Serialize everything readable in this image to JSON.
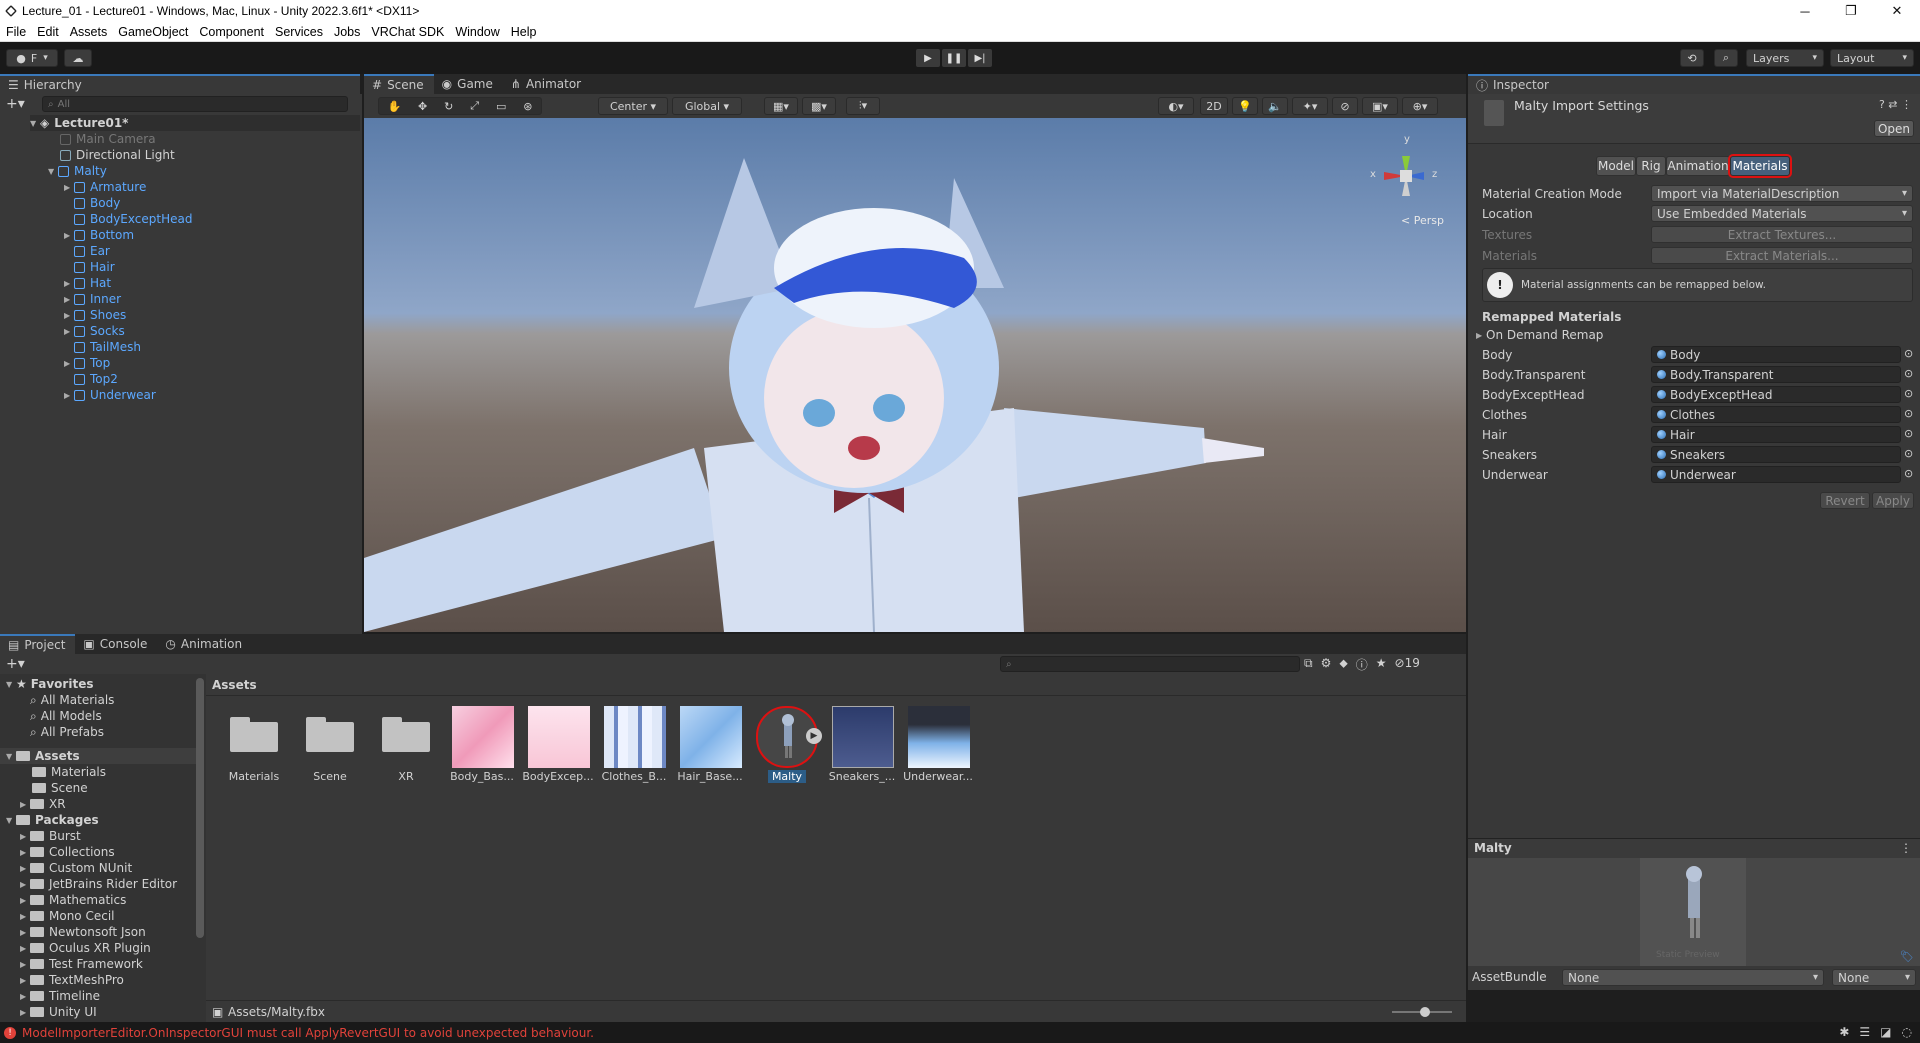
{
  "titlebar": {
    "title": "Lecture_01 - Lecture01 - Windows, Mac, Linux - Unity 2022.3.6f1* <DX11>",
    "minimize": "─",
    "maximize": "❐",
    "close": "✕"
  },
  "menu": [
    "File",
    "Edit",
    "Assets",
    "GameObject",
    "Component",
    "Services",
    "Jobs",
    "VRChat SDK",
    "Window",
    "Help"
  ],
  "toolbar": {
    "account": "F",
    "layers": "Layers",
    "layout": "Layout"
  },
  "hierarchy": {
    "tab": "Hierarchy",
    "search_placeholder": "All",
    "scene": "Lecture01*",
    "items": [
      {
        "label": "Main Camera",
        "style": "grey"
      },
      {
        "label": "Directional Light",
        "style": "normal"
      },
      {
        "label": "Malty",
        "style": "blue"
      },
      {
        "label": "Armature",
        "style": "blue"
      },
      {
        "label": "Body",
        "style": "blue"
      },
      {
        "label": "BodyExceptHead",
        "style": "blue"
      },
      {
        "label": "Bottom",
        "style": "blue"
      },
      {
        "label": "Ear",
        "style": "blue"
      },
      {
        "label": "Hair",
        "style": "blue"
      },
      {
        "label": "Hat",
        "style": "blue"
      },
      {
        "label": "Inner",
        "style": "blue"
      },
      {
        "label": "Shoes",
        "style": "blue"
      },
      {
        "label": "Socks",
        "style": "blue"
      },
      {
        "label": "TailMesh",
        "style": "blue"
      },
      {
        "label": "Top",
        "style": "blue"
      },
      {
        "label": "Top2",
        "style": "blue"
      },
      {
        "label": "Underwear",
        "style": "blue"
      }
    ]
  },
  "scene_tabs": [
    "Scene",
    "Game",
    "Animator"
  ],
  "scene_toolbar": {
    "pivot": "Center",
    "space": "Global",
    "mode2d": "2D"
  },
  "scene_view": {
    "persp": "< Persp",
    "gizmo_x": "x",
    "gizmo_y": "y",
    "gizmo_z": "z"
  },
  "inspector": {
    "tab": "Inspector",
    "title": "Malty Import Settings",
    "open_btn": "Open",
    "tabs": [
      "Model",
      "Rig",
      "Animation",
      "Materials"
    ],
    "fields": [
      {
        "label": "Material Creation Mode",
        "value": "Import via MaterialDescription"
      },
      {
        "label": "Location",
        "value": "Use Embedded Materials"
      }
    ],
    "textures_label": "Textures",
    "extract_textures": "Extract Textures...",
    "materials_label": "Materials",
    "extract_materials": "Extract Materials...",
    "info": "Material assignments can be remapped below.",
    "remapped_header": "Remapped Materials",
    "on_demand": "On Demand Remap",
    "remaps": [
      {
        "label": "Body",
        "value": "Body"
      },
      {
        "label": "Body.Transparent",
        "value": "Body.Transparent"
      },
      {
        "label": "BodyExceptHead",
        "value": "BodyExceptHead"
      },
      {
        "label": "Clothes",
        "value": "Clothes"
      },
      {
        "label": "Hair",
        "value": "Hair"
      },
      {
        "label": "Sneakers",
        "value": "Sneakers"
      },
      {
        "label": "Underwear",
        "value": "Underwear"
      }
    ],
    "revert": "Revert",
    "apply": "Apply",
    "preview_title": "Malty",
    "preview_caption": "Static Preview",
    "assetbundle_label": "AssetBundle",
    "assetbundle_value": "None",
    "assetbundle_variant": "None"
  },
  "bottom_tabs": [
    "Project",
    "Console",
    "Animation"
  ],
  "project": {
    "search_placeholder": "",
    "hidden_count": "19",
    "breadcrumb": "Assets",
    "path": "Assets/Malty.fbx",
    "favorites": "Favorites",
    "favorite_items": [
      "All Materials",
      "All Models",
      "All Prefabs"
    ],
    "assets_root": "Assets",
    "asset_folders": [
      "Materials",
      "Scene",
      "XR"
    ],
    "packages_root": "Packages",
    "packages": [
      "Burst",
      "Collections",
      "Custom NUnit",
      "JetBrains Rider Editor",
      "Mathematics",
      "Mono Cecil",
      "Newtonsoft Json",
      "Oculus XR Plugin",
      "Test Framework",
      "TextMeshPro",
      "Timeline",
      "Unity UI"
    ],
    "grid": [
      {
        "label": "Materials",
        "kind": "folder"
      },
      {
        "label": "Scene",
        "kind": "folder"
      },
      {
        "label": "XR",
        "kind": "folder"
      },
      {
        "label": "Body_Bas...",
        "kind": "tex-pink"
      },
      {
        "label": "BodyExcep...",
        "kind": "tex-lightpink"
      },
      {
        "label": "Clothes_B...",
        "kind": "tex-clothes"
      },
      {
        "label": "Hair_Base...",
        "kind": "tex-hair"
      },
      {
        "label": "Malty",
        "kind": "model"
      },
      {
        "label": "Sneakers_...",
        "kind": "tex-sneakers"
      },
      {
        "label": "Underwear...",
        "kind": "tex-underwear"
      }
    ]
  },
  "status": {
    "message": "ModelImporterEditor.OnInspectorGUI must call ApplyRevertGUI to avoid unexpected behaviour.",
    "color": "#e0423a"
  }
}
